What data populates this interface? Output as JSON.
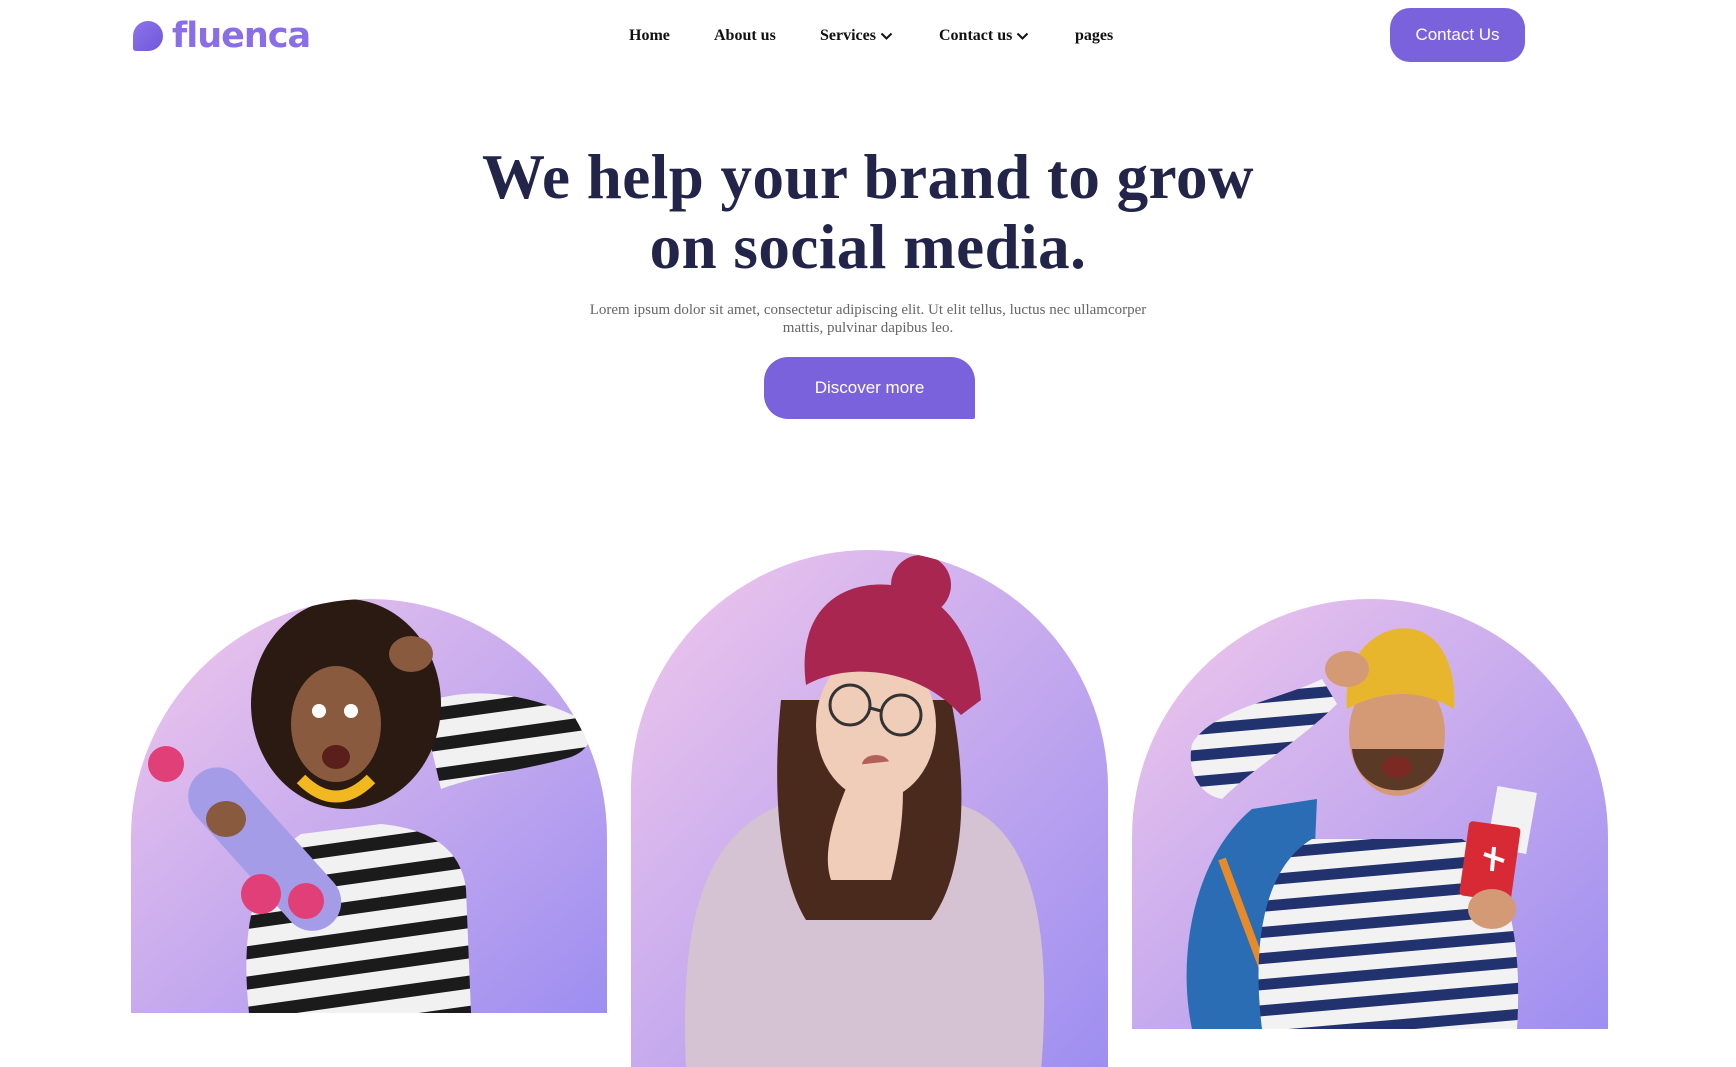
{
  "brand": {
    "name": "fluenca",
    "accent_color": "#7a62dc",
    "logo_color": "#8a6ee8"
  },
  "nav": {
    "items": [
      {
        "label": "Home",
        "has_dropdown": false
      },
      {
        "label": "About us",
        "has_dropdown": false
      },
      {
        "label": "Services",
        "has_dropdown": true
      },
      {
        "label": "Contact us",
        "has_dropdown": true
      },
      {
        "label": "pages",
        "has_dropdown": false
      }
    ],
    "cta_label": "Contact Us"
  },
  "hero": {
    "title": "We help your brand to grow on social media.",
    "description": "Lorem ipsum dolor sit amet, consectetur adipiscing elit. Ut elit tellus, luctus nec ullamcorper mattis, pulvinar dapibus leo.",
    "button_label": "Discover more",
    "title_color": "#22244a"
  },
  "gallery": [
    {
      "subject": "woman-with-skateboard-photo"
    },
    {
      "subject": "woman-in-knit-hat-photo"
    },
    {
      "subject": "man-with-passport-photo"
    }
  ]
}
